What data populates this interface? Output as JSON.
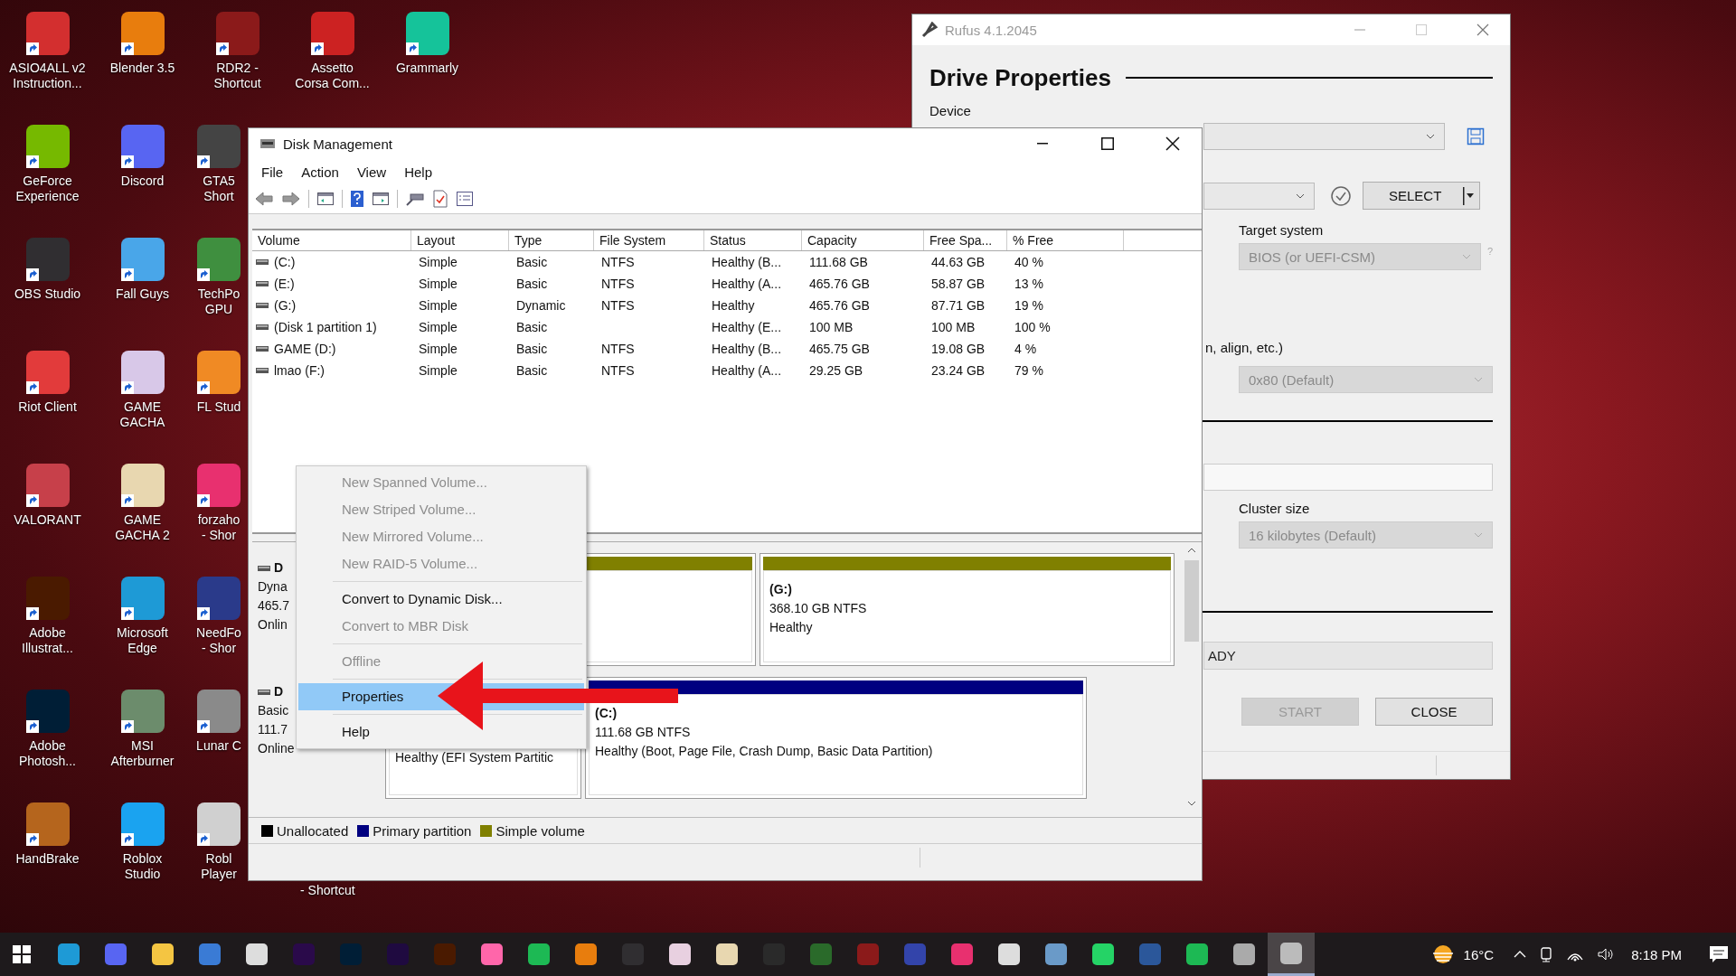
{
  "desktop": {
    "columns": [
      [
        {
          "label": "ASIO4ALL v2\nInstruction...",
          "color": "#d32f2f"
        },
        {
          "label": "GeForce\nExperience",
          "color": "#76b900"
        },
        {
          "label": "OBS Studio",
          "color": "#302e31"
        },
        {
          "label": "Riot Client",
          "color": "#e23b3b"
        },
        {
          "label": "VALORANT",
          "color": "#c7404a"
        },
        {
          "label": "Adobe\nIllustrat...",
          "color": "#4a1a00"
        },
        {
          "label": "Adobe\nPhotosh...",
          "color": "#001e36"
        },
        {
          "label": "HandBrake",
          "color": "#b5651d"
        }
      ],
      [
        {
          "label": "Blender 3.5",
          "color": "#e87d0d"
        },
        {
          "label": "Discord",
          "color": "#5865f2"
        },
        {
          "label": "Fall Guys",
          "color": "#49a6e9"
        },
        {
          "label": "GAME\nGACHA",
          "color": "#d8c8e8"
        },
        {
          "label": "GAME\nGACHA 2",
          "color": "#e8d7b0"
        },
        {
          "label": "Microsoft\nEdge",
          "color": "#1e9ad6"
        },
        {
          "label": "MSI\nAfterburner",
          "color": "#6c8c6c"
        },
        {
          "label": "Roblox\nStudio",
          "color": "#1aa3f0"
        }
      ],
      [
        {
          "label": "RDR2 -\nShortcut",
          "color": "#8b1a1a"
        },
        {
          "label": "GTA5\nShort",
          "color": "#444444"
        },
        {
          "label": "TechPo\nGPU",
          "color": "#3f8f3f"
        },
        {
          "label": "FL Stud",
          "color": "#f08a24"
        },
        {
          "label": "forzaho\n- Shor",
          "color": "#e8306f"
        },
        {
          "label": "NeedFo\n- Shor",
          "color": "#2a3a8a"
        },
        {
          "label": "Lunar C",
          "color": "#8a8a8a"
        },
        {
          "label": "Robl\nPlayer",
          "color": "#d0d0d0"
        }
      ],
      [
        {
          "label": "Assetto\nCorsa Com...",
          "color": "#cc2222"
        }
      ],
      [
        {
          "label": "Grammarly",
          "color": "#15c39a"
        }
      ]
    ],
    "fragment": "- Shortcut"
  },
  "rufus": {
    "title": "Rufus 4.1.2045",
    "heading": "Drive Properties",
    "device_label": "Device",
    "select_button": "SELECT",
    "target_label": "Target system",
    "target": {
      "value": "BIOS (or UEFI-CSM)",
      "disabled": true
    },
    "help_mark": "?",
    "partial_label": "n, align, etc.)",
    "bios_id": {
      "value": "0x80 (Default)",
      "disabled": true
    },
    "cluster_label": "Cluster size",
    "cluster": {
      "value": "16 kilobytes (Default)",
      "disabled": true
    },
    "status": "ADY",
    "start_button": {
      "label": "START",
      "disabled": true
    },
    "close_button": {
      "label": "CLOSE",
      "disabled": false
    }
  },
  "disk_management": {
    "title": "Disk Management",
    "menu": [
      "File",
      "Action",
      "View",
      "Help"
    ],
    "columns": [
      "Volume",
      "Layout",
      "Type",
      "File System",
      "Status",
      "Capacity",
      "Free Spa...",
      "% Free"
    ],
    "rows": [
      [
        "(C:)",
        "Simple",
        "Basic",
        "NTFS",
        "Healthy (B...",
        "111.68 GB",
        "44.63 GB",
        "40 %"
      ],
      [
        "(E:)",
        "Simple",
        "Basic",
        "NTFS",
        "Healthy (A...",
        "465.76 GB",
        "58.87 GB",
        "13 %"
      ],
      [
        "(G:)",
        "Simple",
        "Dynamic",
        "NTFS",
        "Healthy",
        "465.76 GB",
        "87.71 GB",
        "19 %"
      ],
      [
        "(Disk 1 partition 1)",
        "Simple",
        "Basic",
        "",
        "Healthy (E...",
        "100 MB",
        "100 MB",
        "100 %"
      ],
      [
        "GAME (D:)",
        "Simple",
        "Basic",
        "NTFS",
        "Healthy (B...",
        "465.75 GB",
        "19.08 GB",
        "4 %"
      ],
      [
        "lmao (F:)",
        "Simple",
        "Basic",
        "NTFS",
        "Healthy (A...",
        "29.25 GB",
        "23.24 GB",
        "79 %"
      ]
    ],
    "disks": [
      {
        "name": "D",
        "lines": [
          "Dyna",
          "465.7",
          "Onlin"
        ],
        "partitions": [
          {
            "color": "#808000"
          },
          {
            "color": "#808000",
            "lines": [
              "(G:)",
              "368.10 GB NTFS",
              "Healthy"
            ]
          }
        ]
      },
      {
        "name": "D",
        "lines": [
          "Basic",
          "111.7",
          "Online"
        ],
        "partitions": [
          {
            "lines": [
              "Healthy (EFI System Partitic"
            ]
          },
          {
            "color": "#000080",
            "lines": [
              "(C:)",
              "111.68 GB NTFS",
              "Healthy (Boot, Page File, Crash Dump, Basic Data Partition)"
            ]
          }
        ]
      }
    ],
    "legend": [
      {
        "label": "Unallocated",
        "color": "#000000"
      },
      {
        "label": "Primary partition",
        "color": "#000080"
      },
      {
        "label": "Simple volume",
        "color": "#808000"
      }
    ]
  },
  "context_menu": {
    "groups": [
      [
        {
          "label": "New Spanned Volume...",
          "disabled": true,
          "selected": false
        },
        {
          "label": "New Striped Volume...",
          "disabled": true,
          "selected": false
        },
        {
          "label": "New Mirrored Volume...",
          "disabled": true,
          "selected": false
        },
        {
          "label": "New RAID-5 Volume...",
          "disabled": true,
          "selected": false
        }
      ],
      [
        {
          "label": "Convert to Dynamic Disk...",
          "disabled": false,
          "selected": false
        },
        {
          "label": "Convert to MBR Disk",
          "disabled": true,
          "selected": false
        }
      ],
      [
        {
          "label": "Offline",
          "disabled": true,
          "selected": false
        }
      ],
      [
        {
          "label": "Properties",
          "disabled": false,
          "selected": true
        }
      ],
      [
        {
          "label": "Help",
          "disabled": false,
          "selected": false
        }
      ]
    ]
  },
  "taskbar": {
    "apps": [
      {
        "color": "#1e9ad6",
        "selected": false
      },
      {
        "color": "#5865f2",
        "selected": false
      },
      {
        "color": "#f4c542",
        "selected": false
      },
      {
        "color": "#3a7bd5",
        "selected": false
      },
      {
        "color": "#dddddd",
        "selected": false
      },
      {
        "color": "#2a0a4a",
        "selected": false
      },
      {
        "color": "#001e36",
        "selected": false
      },
      {
        "color": "#1f0a40",
        "selected": false
      },
      {
        "color": "#4a1a00",
        "selected": false
      },
      {
        "color": "#ff66aa",
        "selected": false
      },
      {
        "color": "#1db954",
        "selected": false
      },
      {
        "color": "#e87d0d",
        "selected": false
      },
      {
        "color": "#302e31",
        "selected": false
      },
      {
        "color": "#e8d0e0",
        "selected": false
      },
      {
        "color": "#e8d7b0",
        "selected": false
      },
      {
        "color": "#2a2a2a",
        "selected": false
      },
      {
        "color": "#2a6a2a",
        "selected": false
      },
      {
        "color": "#8b1a1a",
        "selected": false
      },
      {
        "color": "#3344aa",
        "selected": false
      },
      {
        "color": "#e8306f",
        "selected": false
      },
      {
        "color": "#dddddd",
        "selected": false
      },
      {
        "color": "#6a9ac8",
        "selected": false
      },
      {
        "color": "#25d366",
        "selected": false
      },
      {
        "color": "#2b579a",
        "selected": false
      },
      {
        "color": "#1db954",
        "selected": false
      },
      {
        "color": "#aaaaaa",
        "selected": false
      },
      {
        "color": "#bbbbbb",
        "selected": true
      }
    ],
    "temperature": "16°C",
    "time": "8:18 PM"
  }
}
